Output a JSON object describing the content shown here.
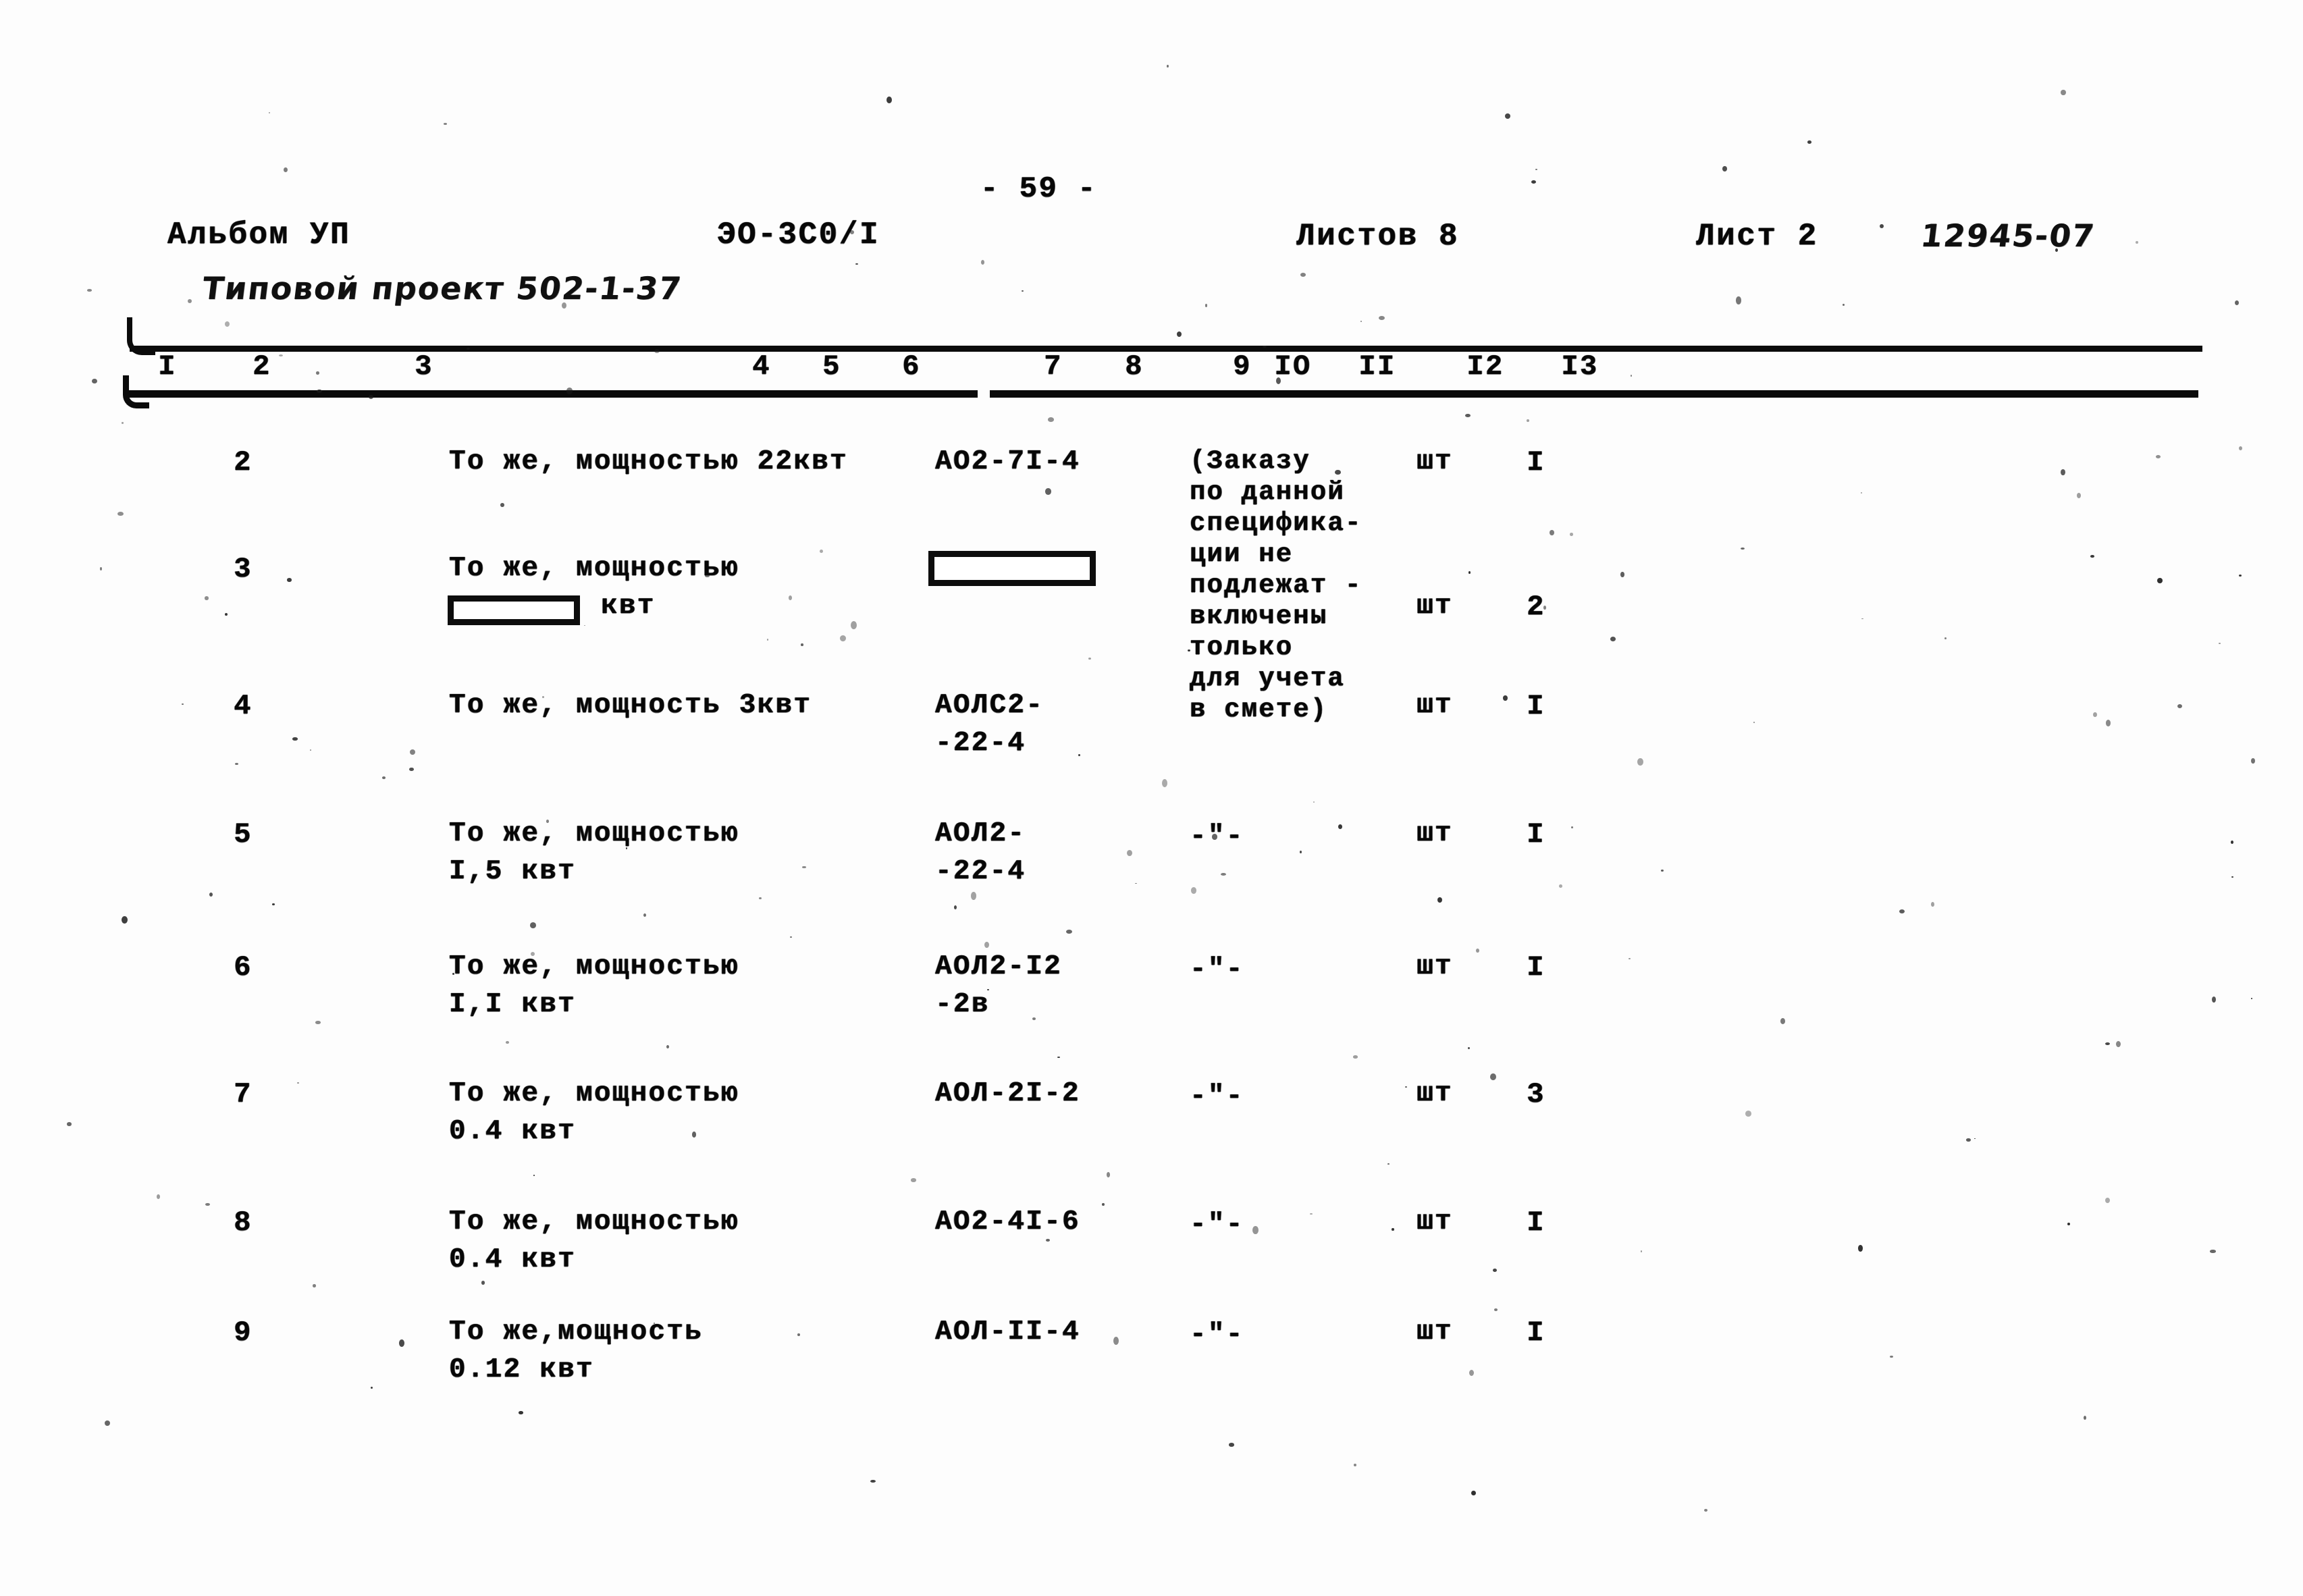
{
  "document": {
    "page_number": "- 59 -",
    "album_label": "Альбом УП",
    "doc_code": "ЭО-3С0/I",
    "sheets_total": "Листов 8",
    "sheet_number": "Лист 2",
    "archive_number": "12945-07",
    "project_label": "Типовой проект 502-1-37"
  },
  "table": {
    "column_headers": [
      "I",
      "2",
      "3",
      "4",
      "5",
      "6",
      "7",
      "8",
      "9",
      "IO",
      "II",
      "I2",
      "I3"
    ],
    "note_block": {
      "lines": [
        "(Заказу",
        "по данной",
        "специфика-",
        "ции не",
        "подлежат -",
        "включены",
        "только",
        "для учета",
        "в смете)"
      ]
    },
    "rows": [
      {
        "num": "2",
        "name_lines": [
          "То же, мощностью 22квт"
        ],
        "code_lines": [
          "АО2-7I-4"
        ],
        "note": "",
        "unit": "шт",
        "qty": "I",
        "redactions": []
      },
      {
        "num": "3",
        "name_lines": [
          "То же, мощностью",
          "квт"
        ],
        "code_lines": [
          ""
        ],
        "note": "",
        "unit": "шт",
        "qty": "2",
        "redactions": [
          "name-value-box",
          "code-box"
        ]
      },
      {
        "num": "4",
        "name_lines": [
          "То же, мощность 3квт"
        ],
        "code_lines": [
          "АОЛС2-",
          "-22-4"
        ],
        "note": "",
        "unit": "шт",
        "qty": "I",
        "redactions": []
      },
      {
        "num": "5",
        "name_lines": [
          "То же, мощностью",
          "I,5 квт"
        ],
        "code_lines": [
          "АОЛ2-",
          "-22-4"
        ],
        "note": "-\"-",
        "unit": "шт",
        "qty": "I",
        "redactions": []
      },
      {
        "num": "6",
        "name_lines": [
          "То же, мощностью",
          "I,I квт"
        ],
        "code_lines": [
          "АОЛ2-I2",
          "-2в"
        ],
        "note": "-\"-",
        "unit": "шт",
        "qty": "I",
        "redactions": []
      },
      {
        "num": "7",
        "name_lines": [
          "То же, мощностью",
          "0.4 квт"
        ],
        "code_lines": [
          "АОЛ-2I-2"
        ],
        "note": "-\"-",
        "unit": "шт",
        "qty": "3",
        "redactions": []
      },
      {
        "num": "8",
        "name_lines": [
          "То же, мощностью",
          "0.4 квт"
        ],
        "code_lines": [
          "АО2-4I-6"
        ],
        "note": "-\"-",
        "unit": "шт",
        "qty": "I",
        "redactions": []
      },
      {
        "num": "9",
        "name_lines": [
          "То же,мощность",
          "0.12 квт"
        ],
        "code_lines": [
          "АОЛ-II-4"
        ],
        "note": "-\"-",
        "unit": "шт",
        "qty": "I",
        "redactions": []
      }
    ]
  },
  "layout": {
    "column_header_x": [
      248,
      388,
      628,
      1128,
      1232,
      1350,
      1560,
      1680,
      1840,
      1915,
      2040,
      2200,
      2340
    ],
    "column_x": {
      "num": 360,
      "name": 665,
      "code": 1385,
      "note": 1762,
      "unit": 2125,
      "qty": 2275
    },
    "row_tops": [
      664,
      822,
      1025,
      1215,
      1412,
      1600,
      1790,
      1953
    ],
    "line_height": 56
  },
  "colors": {
    "ink": "#0b0b0b",
    "paper": "#fdfdfd"
  }
}
